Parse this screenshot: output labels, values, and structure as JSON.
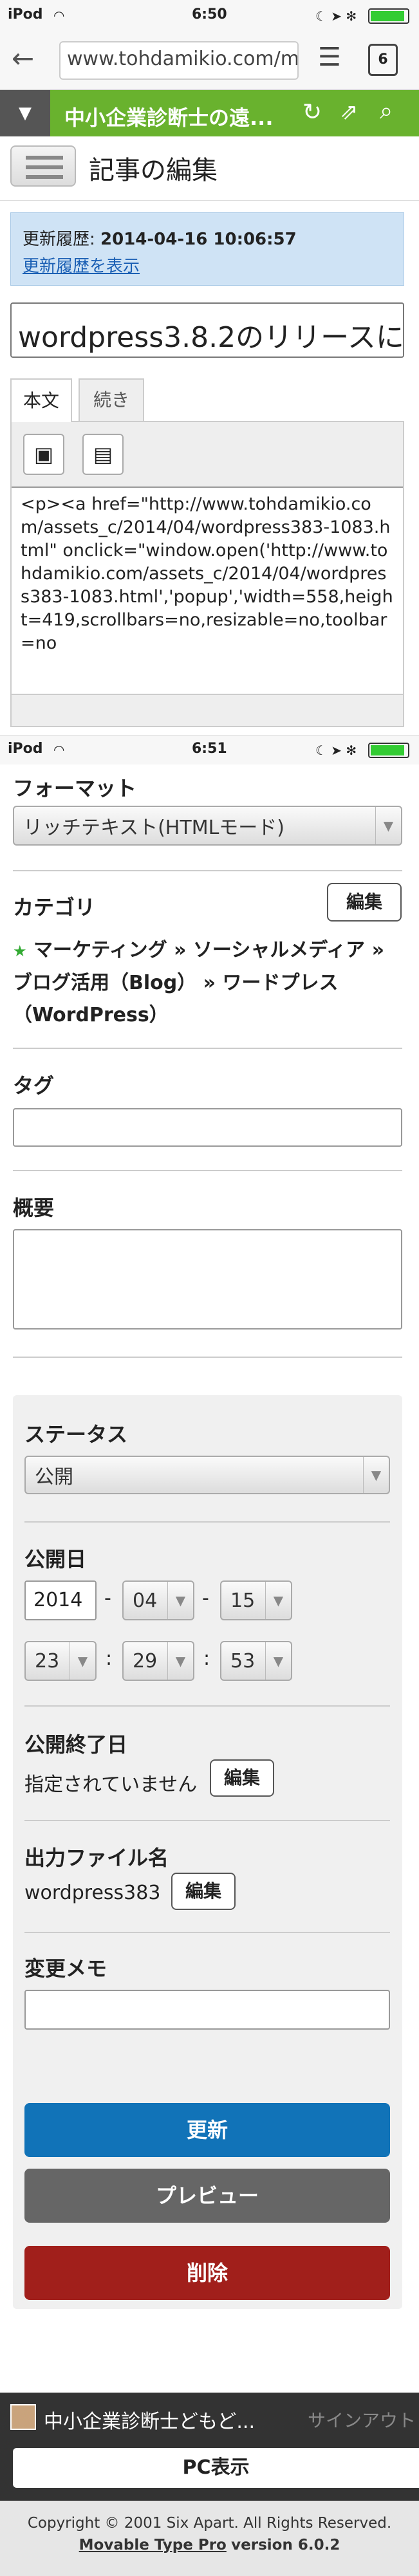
{
  "status1": {
    "carrier": "iPod",
    "time": "6:50"
  },
  "browser": {
    "url": "www.tohdamikio.com/mt",
    "tab_count": "6"
  },
  "appbar": {
    "site_name": "中小企業診断士の遠..."
  },
  "page": {
    "title": "記事の編集"
  },
  "history": {
    "label": "更新履歴:",
    "date": "2014-04-16 10:06:57",
    "link": "更新履歴を表示"
  },
  "entry": {
    "title": "wordpress3.8.2のリリースに",
    "tab_body": "本文",
    "tab_more": "続き",
    "body_text": "<p><a href=\"http://www.tohdamikio.com/assets_c/2014/04/wordpress383-1083.html\" onclick=\"window.open('http://www.tohdamikio.com/assets_c/2014/04/wordpress383-1083.html','popup','width=558,height=419,scrollbars=no,resizable=no,toolbar=no"
  },
  "status2": {
    "carrier": "iPod",
    "time": "6:51"
  },
  "format": {
    "label": "フォーマット",
    "value": "リッチテキスト(HTMLモード)"
  },
  "category": {
    "label": "カテゴリ",
    "edit": "編集",
    "star": "★",
    "value": "マーケティング » ソーシャルメディア » ブログ活用（Blog） » ワードプレス（WordPress）"
  },
  "tags": {
    "label": "タグ",
    "value": ""
  },
  "excerpt": {
    "label": "概要",
    "value": ""
  },
  "status": {
    "label": "ステータス",
    "value": "公開"
  },
  "publish": {
    "label": "公開日",
    "year": "2014",
    "month": "04",
    "day": "15",
    "hour": "23",
    "minute": "29",
    "second": "53",
    "dash": "-",
    "colon": ":"
  },
  "unpublish": {
    "label": "公開終了日",
    "value": "指定されていません",
    "edit": "編集"
  },
  "basename": {
    "label": "出力ファイル名",
    "value": "wordpress383",
    "edit": "編集"
  },
  "memo": {
    "label": "変更メモ",
    "value": ""
  },
  "actions": {
    "update": "更新",
    "preview": "プレビュー",
    "delete": "削除"
  },
  "footer": {
    "user": "中小企業診断士どもど...",
    "signout": "サインアウト",
    "pc_view": "PC表示",
    "copyright": "Copyright © 2001 Six Apart. All Rights Reserved.",
    "product": "Movable Type Pro",
    "version": "version 6.0.2"
  },
  "colors": {
    "green": "#69b22e",
    "blue": "#1173b8",
    "gray": "#666666",
    "red": "#a11f1b"
  }
}
